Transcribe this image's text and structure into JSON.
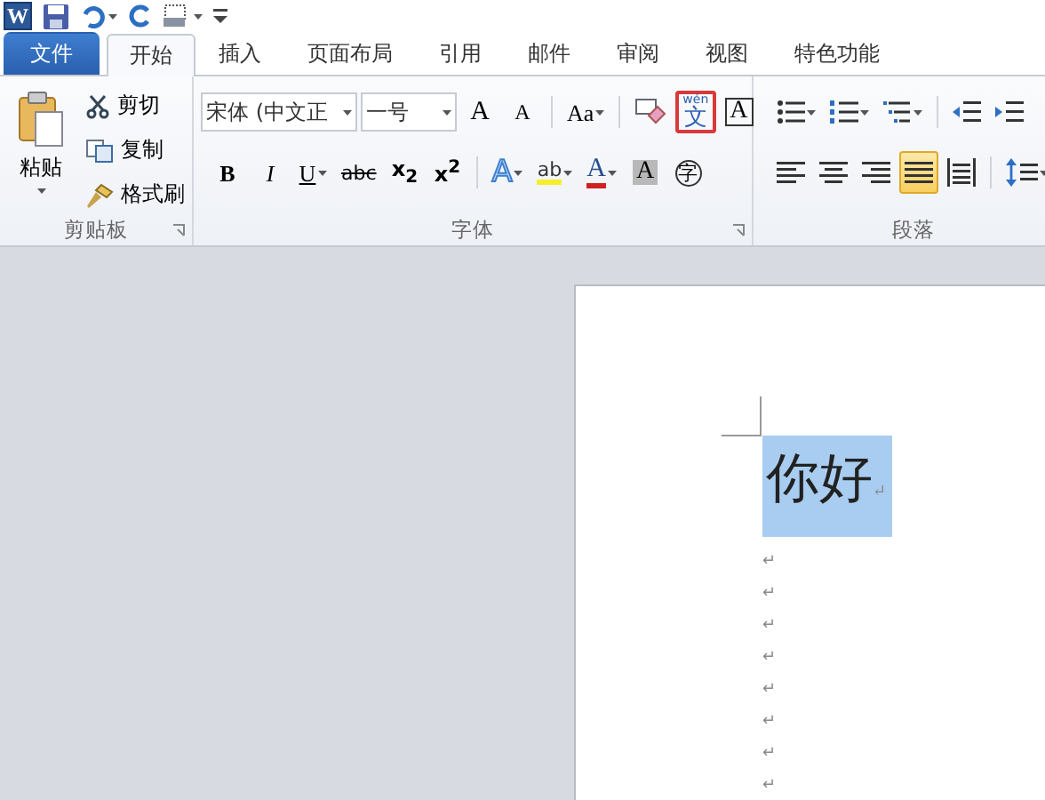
{
  "quick_access_toolbar": {
    "logo": "W",
    "items": [
      {
        "kind": "save",
        "dropdown": false
      },
      {
        "kind": "undo",
        "dropdown": true
      },
      {
        "kind": "redo",
        "dropdown": false
      },
      {
        "kind": "preview",
        "dropdown": true
      },
      {
        "kind": "customize",
        "dropdown": false
      }
    ]
  },
  "tabs": [
    {
      "label": "文件",
      "kind": "file",
      "selected": false
    },
    {
      "label": "开始",
      "kind": "tab",
      "selected": true
    },
    {
      "label": "插入",
      "kind": "tab",
      "selected": false
    },
    {
      "label": "页面布局",
      "kind": "tab",
      "selected": false
    },
    {
      "label": "引用",
      "kind": "tab",
      "selected": false
    },
    {
      "label": "邮件",
      "kind": "tab",
      "selected": false
    },
    {
      "label": "审阅",
      "kind": "tab",
      "selected": false
    },
    {
      "label": "视图",
      "kind": "tab",
      "selected": false
    },
    {
      "label": "特色功能",
      "kind": "tab",
      "selected": false
    }
  ],
  "clipboard": {
    "paste": "粘贴",
    "actions": [
      {
        "label": "剪切",
        "kind": "cut"
      },
      {
        "label": "复制",
        "kind": "copy"
      },
      {
        "label": "格式刷",
        "kind": "painter"
      }
    ],
    "label": "剪贴板"
  },
  "font": {
    "font_name": "宋体 (中文正",
    "font_size": "一号",
    "label": "字体",
    "row_1": [
      {
        "kind": "grow",
        "glyph": "A",
        "dropdown": false,
        "highlighted": false
      },
      {
        "kind": "shrink",
        "glyph": "A",
        "dropdown": false,
        "highlighted": false
      },
      {
        "kind": "case",
        "glyph": "Aa",
        "dropdown": true,
        "highlighted": false
      },
      {
        "kind": "clear",
        "dropdown": false,
        "highlighted": false
      },
      {
        "kind": "phonetic",
        "glyph": "文",
        "ruby": "wén",
        "dropdown": false,
        "highlighted": true
      },
      {
        "kind": "border",
        "glyph": "A",
        "dropdown": false,
        "highlighted": false
      }
    ],
    "row_2": [
      {
        "kind": "bold",
        "glyph": "B",
        "dropdown": false
      },
      {
        "kind": "italic",
        "glyph": "I",
        "dropdown": false
      },
      {
        "kind": "underline",
        "glyph": "U",
        "dropdown": true
      },
      {
        "kind": "strike",
        "glyph": "abc",
        "dropdown": false
      },
      {
        "kind": "subscript",
        "glyph": "x$_{2}$",
        "dropdown": false
      },
      {
        "kind": "superscript",
        "glyph": "x$^{2}$",
        "dropdown": false
      },
      {
        "kind": "effects",
        "glyph": "A",
        "dropdown": true
      },
      {
        "kind": "highlight",
        "glyph": "ab",
        "dropdown": true
      },
      {
        "kind": "color",
        "glyph": "A",
        "dropdown": true
      },
      {
        "kind": "shading",
        "glyph": "A",
        "dropdown": false
      },
      {
        "kind": "enclose",
        "glyph": "字",
        "dropdown": false
      }
    ]
  },
  "paragraph": {
    "label": "段落",
    "row_1": [
      {
        "kind": "bullets",
        "dropdown": true
      },
      {
        "kind": "numbering",
        "dropdown": true
      },
      {
        "kind": "multilevel",
        "dropdown": true
      },
      {
        "kind": "outdent",
        "dropdown": false
      },
      {
        "kind": "indent",
        "dropdown": false
      }
    ],
    "row_2": [
      {
        "kind": "left",
        "selected": false
      },
      {
        "kind": "center",
        "selected": false
      },
      {
        "kind": "right",
        "selected": false
      },
      {
        "kind": "justify",
        "selected": true
      },
      {
        "kind": "distributed",
        "selected": false
      },
      {
        "kind": "spacing",
        "selected": false
      }
    ]
  },
  "document": {
    "paragraphs": [
      {
        "text": "你好",
        "mark": "↵",
        "selected": true
      },
      {
        "mark": "↵",
        "selected": false
      },
      {
        "mark": "↵",
        "selected": false
      },
      {
        "mark": "↵",
        "selected": false
      },
      {
        "mark": "↵",
        "selected": false
      },
      {
        "mark": "↵",
        "selected": false
      },
      {
        "mark": "↵",
        "selected": false
      },
      {
        "mark": "↵",
        "selected": false
      },
      {
        "mark": "↵",
        "selected": false
      }
    ]
  }
}
